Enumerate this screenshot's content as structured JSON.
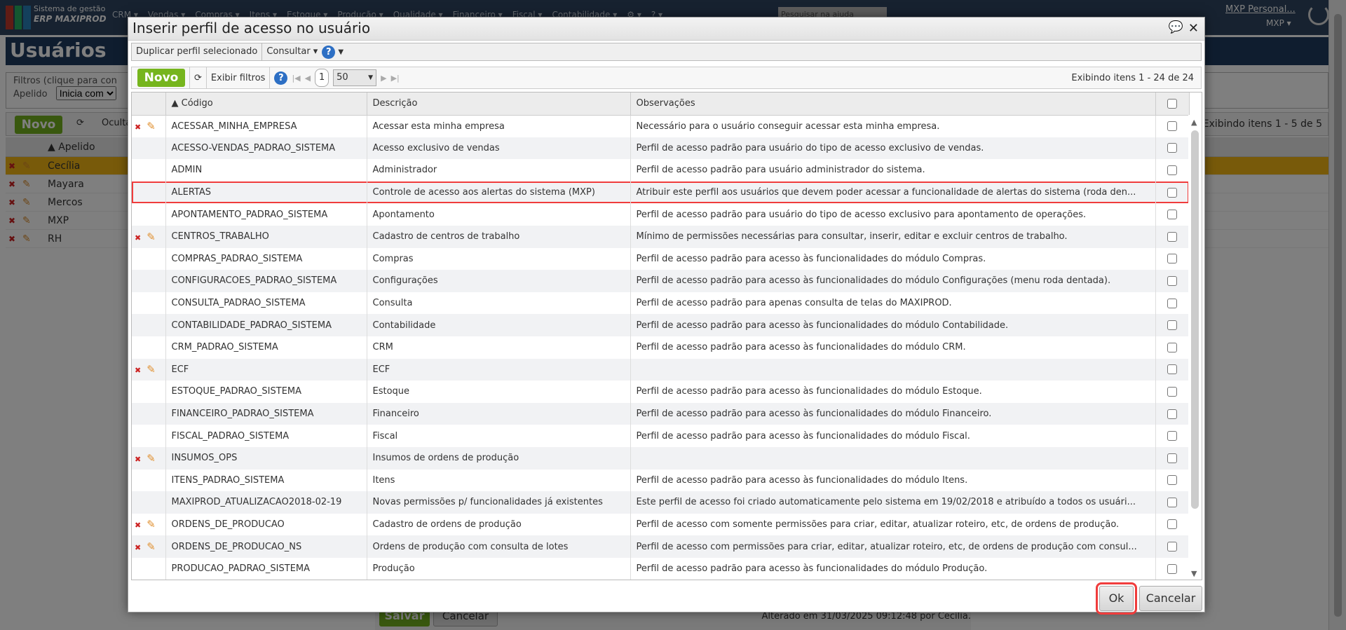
{
  "app": {
    "brand_line1": "Sistema de gestão",
    "brand_line2": "ERP MAXIPROD",
    "menu": [
      "CRM ▾",
      "Vendas ▾",
      "Compras ▾",
      "Itens ▾",
      "Estoque ▾",
      "Produção ▾",
      "Qualidade ▾",
      "Financeiro ▾",
      "Fiscal ▾",
      "Contabilidade ▾",
      "⚙ ▾",
      "? ▾"
    ],
    "search_help": "Pesquisar na ajuda",
    "user": "MXP Personal...",
    "company": "MXP ▾"
  },
  "page": {
    "title": "Usuários",
    "filters_legend": "Filtros (clique para con",
    "filter_label": "Apelido",
    "filter_op": "Inicia com",
    "novo": "Novo",
    "ocultar": "Oculta",
    "count": "Exibindo itens 1 - 5 de 5",
    "col_apelido": "▲ Apelido",
    "users": [
      "Cecília",
      "Mayara",
      "Mercos",
      "MXP",
      "RH"
    ],
    "save": "Salvar",
    "cancel": "Cancelar",
    "altered": "Alterado em 31/03/2025 09:12:48 por Cecília."
  },
  "dialog": {
    "title": "Inserir perfil de acesso no usuário",
    "duplicate": "Duplicar perfil selecionado",
    "consultar": "Consultar ▾",
    "help": "?",
    "novo": "Novo",
    "exibir_filtros": "Exibir filtros",
    "page": "1",
    "per_page": "50",
    "count": "Exibindo itens 1 - 24 de 24",
    "columns": {
      "codigo": "▲ Código",
      "descricao": "Descrição",
      "observacoes": "Observações"
    },
    "ok": "Ok",
    "cancel": "Cancelar",
    "rows": [
      {
        "edit": true,
        "codigo": "ACESSAR_MINHA_EMPRESA",
        "descricao": "Acessar esta minha empresa",
        "obs": "Necessário para o usuário conseguir acessar esta minha empresa."
      },
      {
        "edit": false,
        "codigo": "ACESSO-VENDAS_PADRAO_SISTEMA",
        "descricao": "Acesso exclusivo de vendas",
        "obs": "Perfil de acesso padrão para usuário do tipo de acesso exclusivo de vendas."
      },
      {
        "edit": false,
        "codigo": "ADMIN",
        "descricao": "Administrador",
        "obs": "Perfil de acesso padrão para usuário administrador do sistema."
      },
      {
        "edit": false,
        "codigo": "ALERTAS",
        "descricao": "Controle de acesso aos alertas do sistema (MXP)",
        "obs": "Atribuir este perfil aos usuários que devem poder acessar a funcionalidade de alertas do sistema (roda den...",
        "highlight": true
      },
      {
        "edit": false,
        "codigo": "APONTAMENTO_PADRAO_SISTEMA",
        "descricao": "Apontamento",
        "obs": "Perfil de acesso padrão para usuário do tipo de acesso exclusivo para apontamento de operações."
      },
      {
        "edit": true,
        "codigo": "CENTROS_TRABALHO",
        "descricao": "Cadastro de centros de trabalho",
        "obs": "Mínimo de permissões necessárias para consultar, inserir, editar e excluir centros de trabalho."
      },
      {
        "edit": false,
        "codigo": "COMPRAS_PADRAO_SISTEMA",
        "descricao": "Compras",
        "obs": "Perfil de acesso padrão para acesso às funcionalidades do módulo Compras."
      },
      {
        "edit": false,
        "codigo": "CONFIGURACOES_PADRAO_SISTEMA",
        "descricao": "Configurações",
        "obs": "Perfil de acesso padrão para acesso às funcionalidades do módulo Configurações (menu roda dentada)."
      },
      {
        "edit": false,
        "codigo": "CONSULTA_PADRAO_SISTEMA",
        "descricao": "Consulta",
        "obs": "Perfil de acesso padrão para apenas consulta de telas do MAXIPROD."
      },
      {
        "edit": false,
        "codigo": "CONTABILIDADE_PADRAO_SISTEMA",
        "descricao": "Contabilidade",
        "obs": "Perfil de acesso padrão para acesso às funcionalidades do módulo Contabilidade."
      },
      {
        "edit": false,
        "codigo": "CRM_PADRAO_SISTEMA",
        "descricao": "CRM",
        "obs": "Perfil de acesso padrão para acesso às funcionalidades do módulo CRM."
      },
      {
        "edit": true,
        "codigo": "ECF",
        "descricao": "ECF",
        "obs": ""
      },
      {
        "edit": false,
        "codigo": "ESTOQUE_PADRAO_SISTEMA",
        "descricao": "Estoque",
        "obs": "Perfil de acesso padrão para acesso às funcionalidades do módulo Estoque."
      },
      {
        "edit": false,
        "codigo": "FINANCEIRO_PADRAO_SISTEMA",
        "descricao": "Financeiro",
        "obs": "Perfil de acesso padrão para acesso às funcionalidades do módulo Financeiro."
      },
      {
        "edit": false,
        "codigo": "FISCAL_PADRAO_SISTEMA",
        "descricao": "Fiscal",
        "obs": "Perfil de acesso padrão para acesso às funcionalidades do módulo Fiscal."
      },
      {
        "edit": true,
        "codigo": "INSUMOS_OPS",
        "descricao": "Insumos de ordens de produção",
        "obs": ""
      },
      {
        "edit": false,
        "codigo": "ITENS_PADRAO_SISTEMA",
        "descricao": "Itens",
        "obs": "Perfil de acesso padrão para acesso às funcionalidades do módulo Itens."
      },
      {
        "edit": false,
        "codigo": "MAXIPROD_ATUALIZACAO2018-02-19",
        "descricao": "Novas permissões p/ funcionalidades já existentes",
        "obs": "Este perfil de acesso foi criado automaticamente pelo sistema em 19/02/2018 e atribuído a todos os usuári..."
      },
      {
        "edit": true,
        "codigo": "ORDENS_DE_PRODUCAO",
        "descricao": "Cadastro de ordens de produção",
        "obs": "Perfil de acesso com somente permissões para criar, editar, atualizar roteiro, etc, de ordens de produção."
      },
      {
        "edit": true,
        "codigo": "ORDENS_DE_PRODUCAO_NS",
        "descricao": "Ordens de produção com consulta de lotes",
        "obs": "Perfil de acesso com permissões para criar, editar, atualizar roteiro, etc, de ordens de produção com consul..."
      },
      {
        "edit": false,
        "codigo": "PRODUCAO_PADRAO_SISTEMA",
        "descricao": "Produção",
        "obs": "Perfil de acesso padrão para acesso às funcionalidades do módulo Produção."
      }
    ]
  }
}
